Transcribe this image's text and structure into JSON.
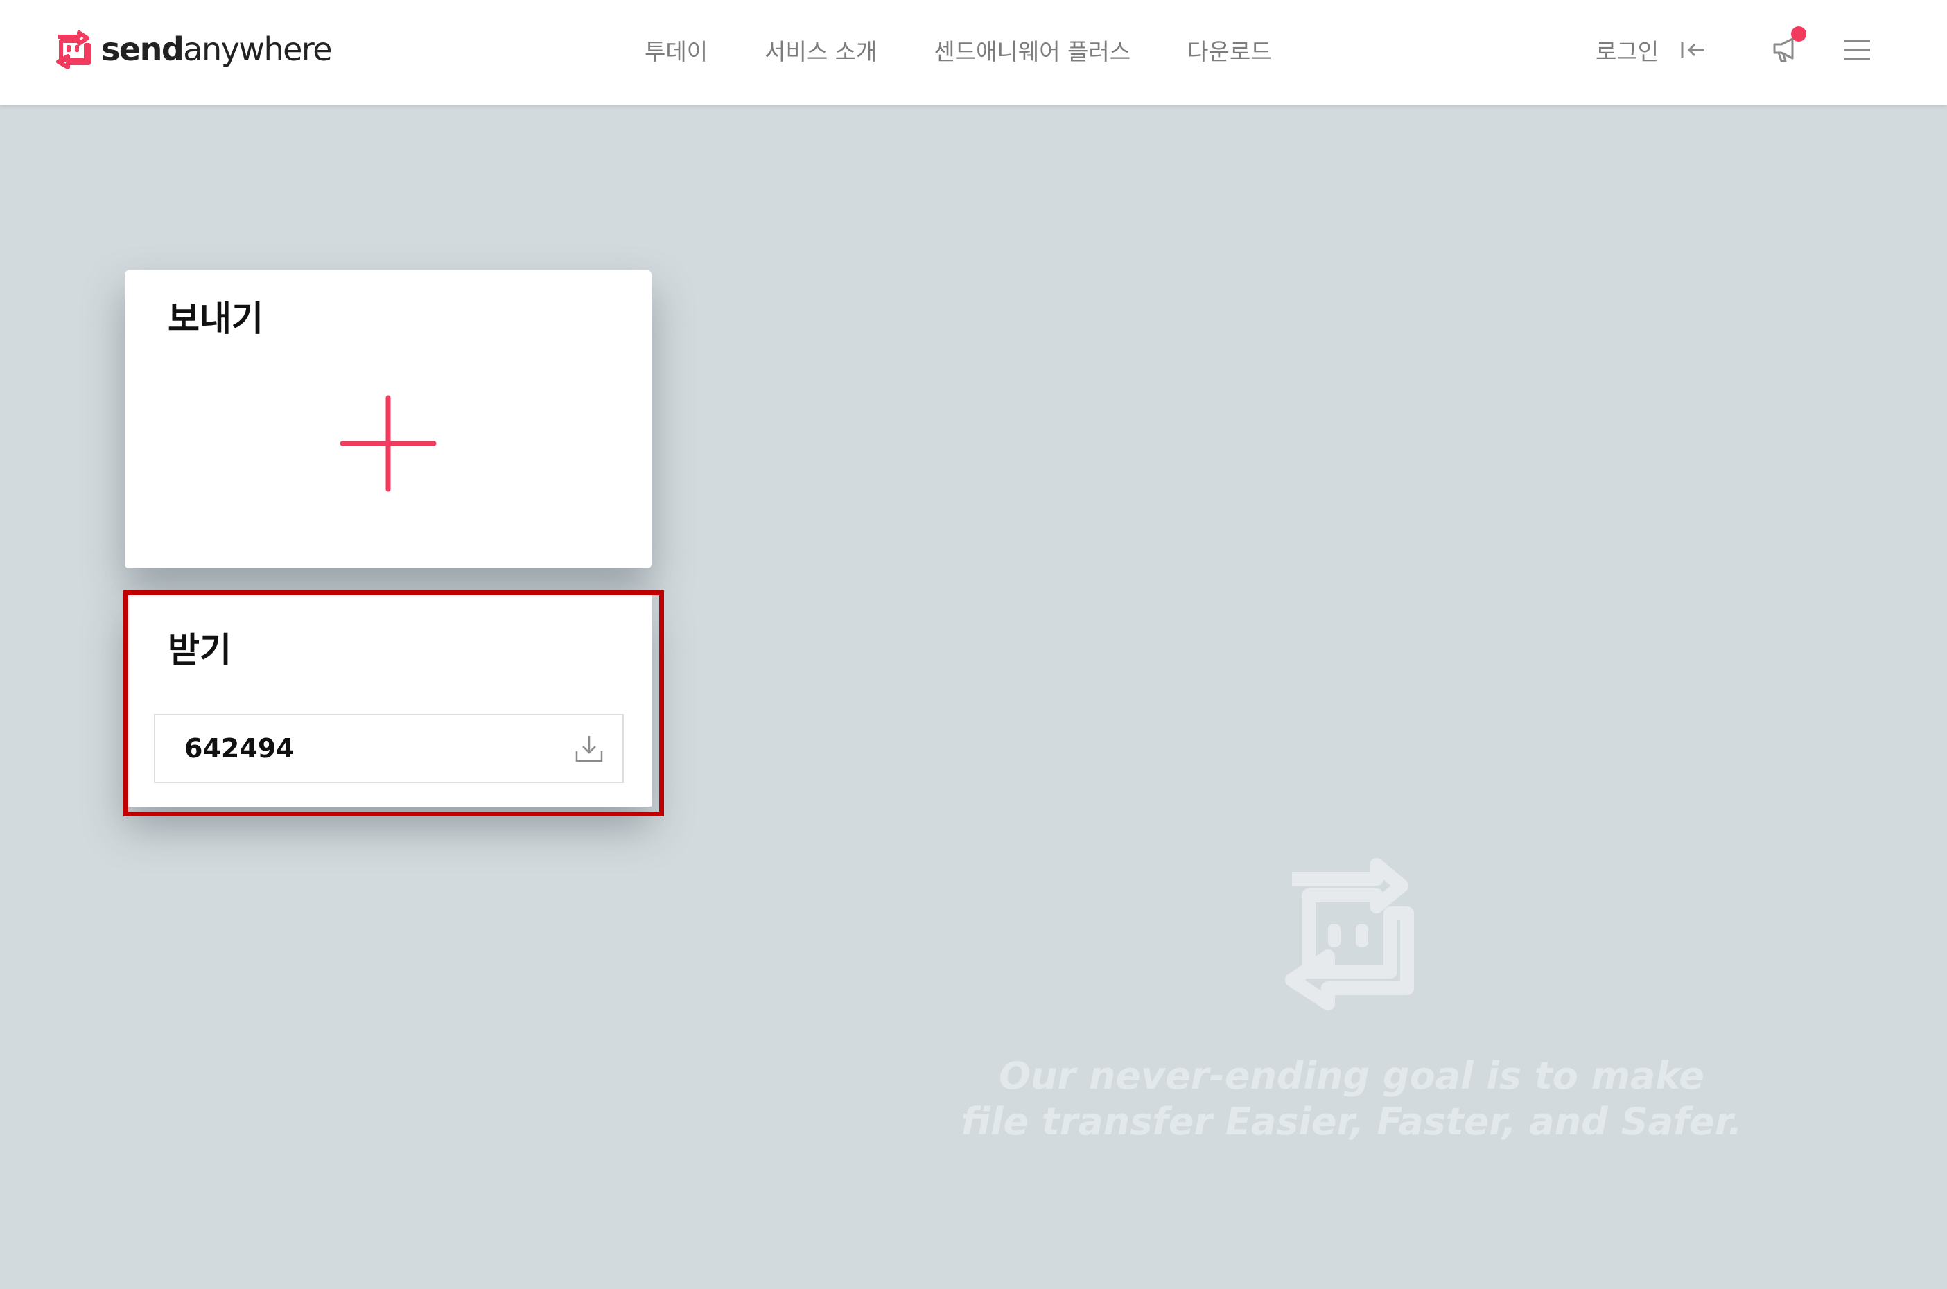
{
  "header": {
    "logo": {
      "part1": "send",
      "part2": "anywhere",
      "icon": "sendanywhere-logo-icon"
    },
    "nav": [
      {
        "label": "투데이"
      },
      {
        "label": "서비스 소개"
      },
      {
        "label": "센드애니웨어 플러스"
      },
      {
        "label": "다운로드"
      }
    ],
    "login_label": "로그인",
    "login_icon": "login-arrow-icon",
    "notice_icon": "megaphone-icon",
    "menu_icon": "hamburger-menu-icon"
  },
  "send_card": {
    "title": "보내기",
    "add_icon": "plus-icon"
  },
  "receive_card": {
    "title": "받기",
    "key_value": "642494",
    "download_icon": "download-icon"
  },
  "tagline": {
    "line1": "Our never-ending goal is to make",
    "line2": "file transfer Easier, Faster, and Safer."
  },
  "colors": {
    "accent": "#f23a5e",
    "background": "#d3dadd",
    "highlight_border": "#c00000"
  }
}
